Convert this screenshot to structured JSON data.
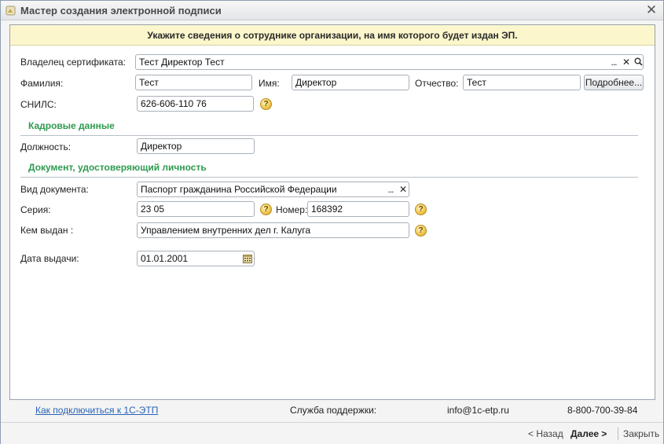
{
  "window": {
    "title": "Мастер создания электронной подписи",
    "close_glyph": "✕"
  },
  "banner": {
    "text": "Укажите сведения о сотруднике организации, на имя которого будет издан ЭП."
  },
  "owner": {
    "label": "Владелец сертификата:",
    "value": "Тест Директор Тест",
    "select_glyph": "...",
    "clear_glyph": "✕",
    "search_glyph": "🔍"
  },
  "name": {
    "last_label": "Фамилия:",
    "last_value": "Тест",
    "first_label": "Имя:",
    "first_value": "Директор",
    "middle_label": "Отчество:",
    "middle_value": "Тест",
    "more_button": "Подробнее..."
  },
  "snils": {
    "label": "СНИЛС:",
    "value": "626-606-110 76"
  },
  "hr_section": {
    "title": "Кадровые данные",
    "position_label": "Должность:",
    "position_value": "Директор"
  },
  "id_section": {
    "title": "Документ, удостоверяющий личность",
    "doc_type_label": "Вид документа:",
    "doc_type_value": "Паспорт гражданина Российской Федерации",
    "series_label": "Серия:",
    "series_value": "23 05",
    "number_label": "Номер:",
    "number_value": "168392",
    "issued_by_label": "Кем выдан :",
    "issued_by_value": "Управлением внутренних дел г. Калуга",
    "issue_date_label": "Дата выдачи:",
    "issue_date_value": "01.01.2001"
  },
  "help_glyph": "?",
  "footer": {
    "connect_link": "Как подключиться к 1С-ЭТП",
    "support_label": "Служба поддержки:",
    "support_email": "info@1c-etp.ru",
    "support_phone": "8-800-700-39-84"
  },
  "navigation": {
    "back": "< Назад",
    "next": "Далее >",
    "close": "Закрыть"
  },
  "colors": {
    "banner_bg": "#fbf6cc",
    "section_title": "#2e9a4f",
    "link": "#2a63b5"
  }
}
